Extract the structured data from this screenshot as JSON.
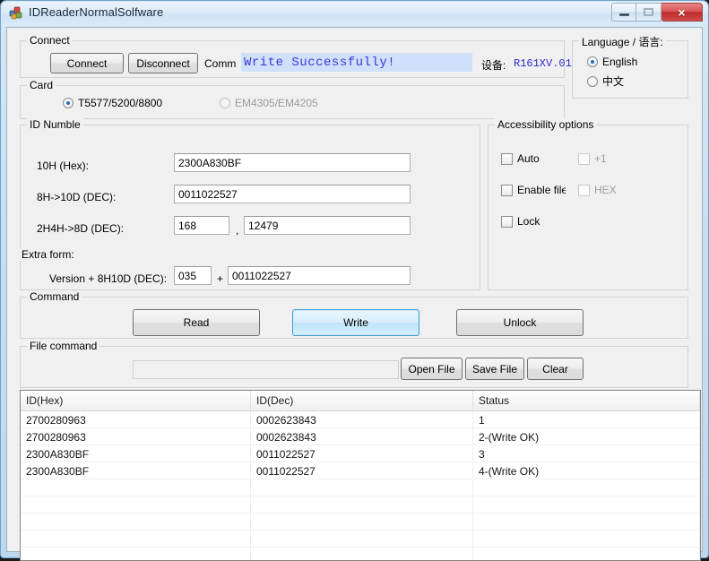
{
  "window": {
    "title": "IDReaderNormalSolfware",
    "icon": "app-icon",
    "minimize_label": "",
    "maximize_label": "",
    "close_label": "×"
  },
  "connect": {
    "group_title": "Connect",
    "connect_button": "Connect",
    "disconnect_button": "Disconnect",
    "comm_label": "Comm",
    "comm_status": "Write Successfully!",
    "comm_status_color": "#3b38d6",
    "comm_status_bg": "#cfe0fb",
    "device_label": "设备:",
    "device_value": "R161XV.01",
    "device_value_color": "#2d2ad0"
  },
  "language": {
    "group_title": "Language / 语言:",
    "options": [
      {
        "label": "English",
        "selected": true
      },
      {
        "label": "中文",
        "selected": false
      }
    ]
  },
  "card": {
    "group_title": "Card",
    "options": [
      {
        "label": "T5577/5200/8800",
        "selected": true,
        "disabled": false
      },
      {
        "label": "EM4305/EM4205",
        "selected": false,
        "disabled": true
      }
    ]
  },
  "id_numble": {
    "group_title": "ID Numble",
    "fields": [
      {
        "label": "10H (Hex):",
        "value": "2300A830BF"
      },
      {
        "label": "8H->10D (DEC):",
        "value": "0011022527"
      }
    ],
    "pair_field": {
      "label": "2H4H->8D (DEC):",
      "value_a": "168",
      "separator": ",",
      "value_b": "12479"
    },
    "extra_form": {
      "label": "Extra form:",
      "row_label": "Version + 8H10D (DEC):",
      "version": "035",
      "plus": "+",
      "value": "0011022527"
    }
  },
  "accessibility": {
    "group_title": "Accessibility options",
    "checkboxes": [
      {
        "label": "Auto",
        "checked": false,
        "disabled": false
      },
      {
        "label": "+1",
        "checked": false,
        "disabled": true
      },
      {
        "label": "Enable file",
        "checked": false,
        "disabled": false
      },
      {
        "label": "HEX",
        "checked": false,
        "disabled": true
      },
      {
        "label": "Lock",
        "checked": false,
        "disabled": false
      }
    ]
  },
  "command": {
    "group_title": "Command",
    "read_button": "Read",
    "write_button": "Write",
    "unlock_button": "Unlock",
    "focused_button": "Write"
  },
  "file_command": {
    "group_title": "File command",
    "path_value": "",
    "path_placeholder": "",
    "open_button": "Open File",
    "save_button": "Save File",
    "clear_button": "Clear"
  },
  "table": {
    "columns": [
      "ID(Hex)",
      "ID(Dec)",
      "Status"
    ],
    "rows": [
      [
        "2700280963",
        "0002623843",
        "1"
      ],
      [
        "2700280963",
        "0002623843",
        "2-(Write OK)"
      ],
      [
        "2300A830BF",
        "0011022527",
        "3"
      ],
      [
        "2300A830BF",
        "0011022527",
        "4-(Write OK)"
      ],
      [
        "",
        "",
        ""
      ],
      [
        "",
        "",
        ""
      ],
      [
        "",
        "",
        ""
      ],
      [
        "",
        "",
        ""
      ],
      [
        "",
        "",
        ""
      ]
    ]
  }
}
